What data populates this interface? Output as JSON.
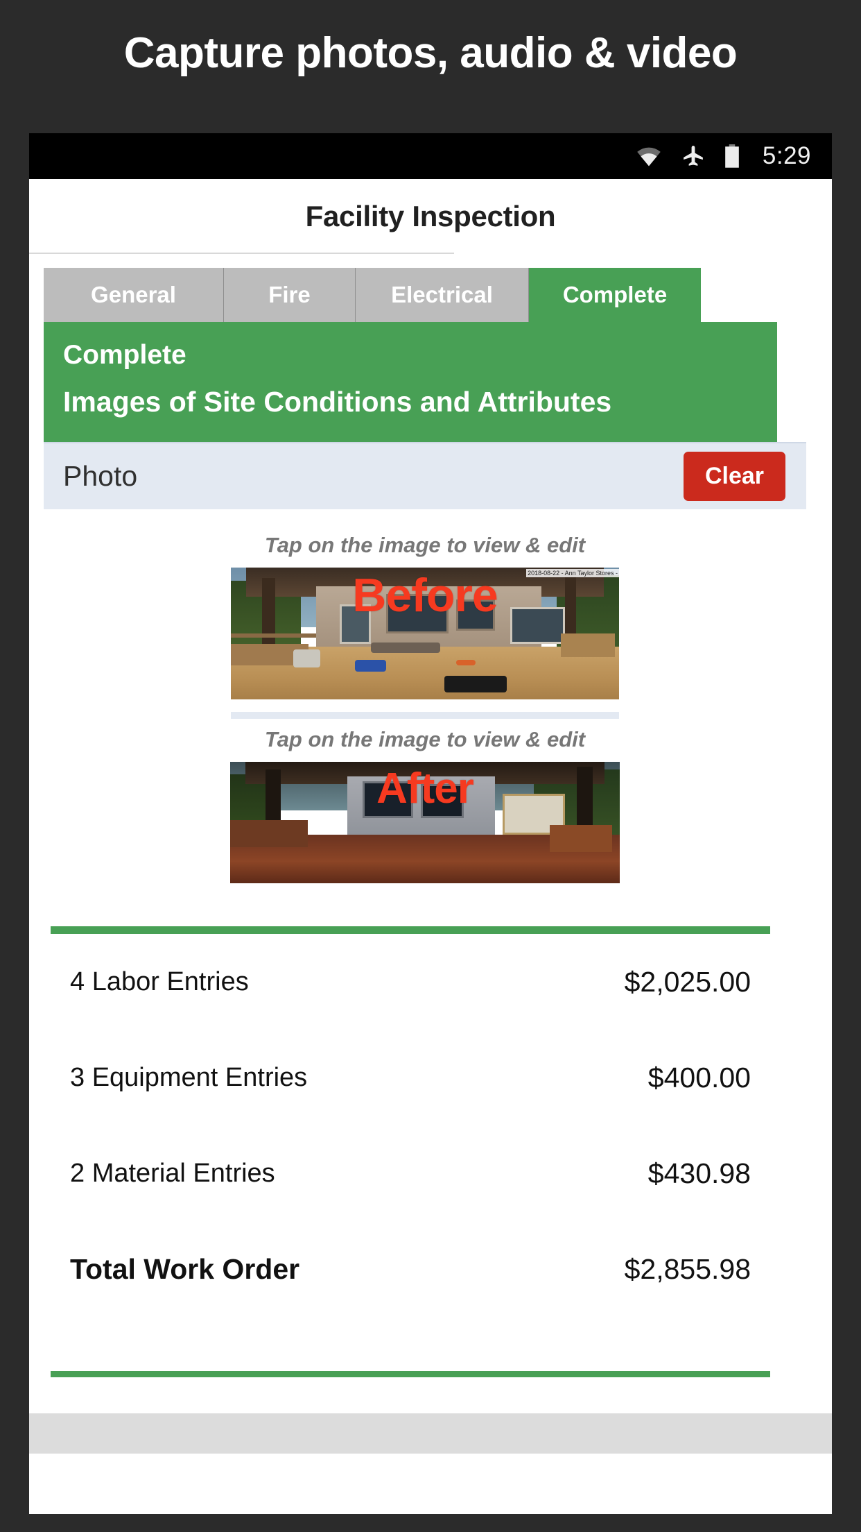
{
  "promo": {
    "title": "Capture photos, audio & video"
  },
  "statusbar": {
    "time": "5:29",
    "icons": [
      "wifi-icon",
      "airplane-mode-icon",
      "battery-icon"
    ]
  },
  "app": {
    "title": "Facility Inspection"
  },
  "tabs": [
    {
      "label": "General",
      "active": false
    },
    {
      "label": "Fire",
      "active": false
    },
    {
      "label": "Electrical",
      "active": false
    },
    {
      "label": "Complete",
      "active": true
    }
  ],
  "section": {
    "status": "Complete",
    "title": "Images of Site Conditions and Attributes"
  },
  "photo_row": {
    "label": "Photo",
    "clear_label": "Clear"
  },
  "photos": [
    {
      "hint": "Tap on the image to view & edit",
      "overlay": "Before",
      "watermark": "2018-08-22 - Ann Taylor Stores -"
    },
    {
      "hint": "Tap on the image to view & edit",
      "overlay": "After",
      "watermark": ""
    }
  ],
  "totals": {
    "rows": [
      {
        "label": "4 Labor Entries",
        "value": "$2,025.00"
      },
      {
        "label": "3 Equipment Entries",
        "value": "$400.00"
      },
      {
        "label": "2 Material Entries",
        "value": "$430.98"
      }
    ],
    "total": {
      "label": "Total Work Order",
      "value": "$2,855.98"
    }
  },
  "colors": {
    "accent_green": "#48a055",
    "danger_red": "#cb2a1d",
    "tab_inactive": "#bcbcbc",
    "photo_bar": "#e3e9f2",
    "overlay_red": "#f63a20",
    "page_bg": "#2b2b2b"
  }
}
